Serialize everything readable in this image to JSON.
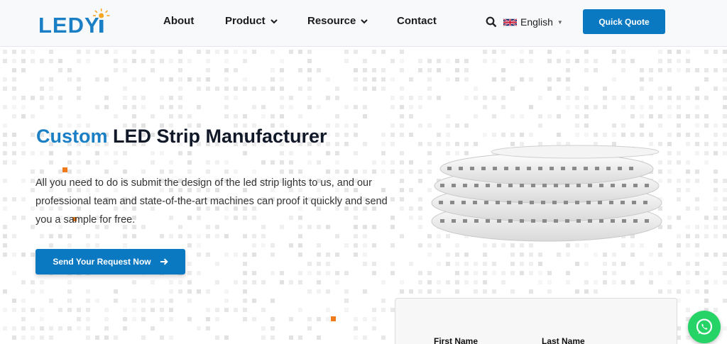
{
  "header": {
    "logo_text": "LEDYi",
    "nav": [
      {
        "label": "About",
        "has_dropdown": false
      },
      {
        "label": "Product",
        "has_dropdown": true
      },
      {
        "label": "Resource",
        "has_dropdown": true
      },
      {
        "label": "Contact",
        "has_dropdown": false
      }
    ],
    "language": "English",
    "quote_label": "Quick Quote",
    "icons": [
      "search-icon",
      "uk-flag-icon",
      "chevron-down-icon"
    ]
  },
  "hero": {
    "title_accent": "Custom",
    "title_rest": " LED Strip Manufacturer",
    "description": "All you need to do is submit the design of the led strip lights to us, and our professional team and state-of-the-art machines can proof it quickly and send you a sample for free.",
    "cta_label": "Send Your Request Now",
    "product_image": "led-strip-reels"
  },
  "form": {
    "first_name_label": "First Name",
    "last_name_label": "Last Name"
  },
  "floating": {
    "whatsapp_icon": "whatsapp-icon"
  },
  "colors": {
    "primary_blue": "#0a79c2",
    "accent_blue": "#1a7fc4",
    "orange": "#f07a1a",
    "whatsapp_green": "#25d366"
  }
}
